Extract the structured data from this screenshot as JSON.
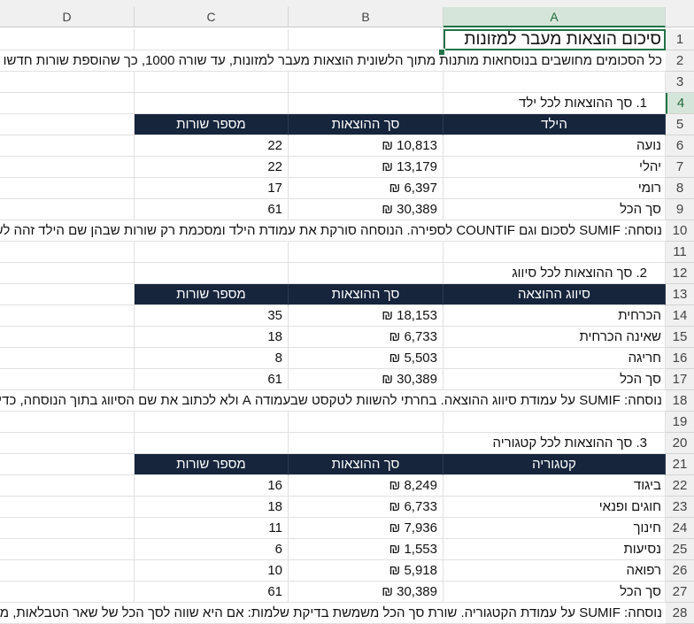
{
  "columns": [
    "A",
    "B",
    "C",
    "D"
  ],
  "rows": [
    "1",
    "2",
    "3",
    "4",
    "5",
    "6",
    "7",
    "8",
    "9",
    "10",
    "11",
    "12",
    "13",
    "14",
    "15",
    "16",
    "17",
    "18",
    "19",
    "20",
    "21",
    "22",
    "23",
    "24",
    "25",
    "26",
    "27",
    "28"
  ],
  "title": "סיכום הוצאות מעבר למזונות",
  "intro": "כל הסכומים מחושבים בנוסחאות מותנות מתוך הלשונית הוצאות מעבר למזונות, עד שורה 1000, כך שהוספת שורות חדשו",
  "section1": {
    "heading": "1. סך ההוצאות לכל ילד",
    "headers": [
      "הילד",
      "סך ההוצאות",
      "מספר שורות"
    ],
    "rows": [
      {
        "name": "נועה",
        "amount": "₪ 10,813",
        "count": "22"
      },
      {
        "name": "יהלי",
        "amount": "₪ 13,179",
        "count": "22"
      },
      {
        "name": "רומי",
        "amount": "₪ 6,397",
        "count": "17"
      },
      {
        "name": "סך הכל",
        "amount": "₪ 30,389",
        "count": "61"
      }
    ],
    "note": "נוסחה: SUMIF לסכום וגם COUNTIF לספירה. הנוסחה סורקת את עמודת הילד ומסכמת רק שורות שבהן שם הילד זהה לש"
  },
  "section2": {
    "heading": "2. סך ההוצאות לכל סיווג",
    "headers": [
      "סיווג ההוצאה",
      "סך ההוצאות",
      "מספר שורות"
    ],
    "rows": [
      {
        "name": "הכרחית",
        "amount": "₪ 18,153",
        "count": "35"
      },
      {
        "name": "שאינה הכרחית",
        "amount": "₪ 6,733",
        "count": "18"
      },
      {
        "name": "חריגה",
        "amount": "₪ 5,503",
        "count": "8"
      },
      {
        "name": "סך הכל",
        "amount": "₪ 30,389",
        "count": "61"
      }
    ],
    "note": "נוסחה: SUMIF על עמודת סיווג ההוצאה. בחרתי להשוות לטקסט שבעמודה A ולא לכתוב את שם הסיווג בתוך הנוסחה, כדי ש"
  },
  "section3": {
    "heading": "3. סך ההוצאות לכל קטגוריה",
    "headers": [
      "קטגוריה",
      "סך ההוצאות",
      "מספר שורות"
    ],
    "rows": [
      {
        "name": "ביגוד",
        "amount": "₪ 8,249",
        "count": "16"
      },
      {
        "name": "חוגים ופנאי",
        "amount": "₪ 6,733",
        "count": "18"
      },
      {
        "name": "חינוך",
        "amount": "₪ 7,936",
        "count": "11"
      },
      {
        "name": "נסיעות",
        "amount": "₪ 1,553",
        "count": "6"
      },
      {
        "name": "רפואה",
        "amount": "₪ 5,918",
        "count": "10"
      },
      {
        "name": "סך הכל",
        "amount": "₪ 30,389",
        "count": "61"
      }
    ],
    "note": "נוסחה: SUMIF על עמודת הקטגוריה. שורת סך הכל משמשת בדיקת שלמות: אם היא שווה לסך הכל של שאר הטבלאות, מו"
  }
}
